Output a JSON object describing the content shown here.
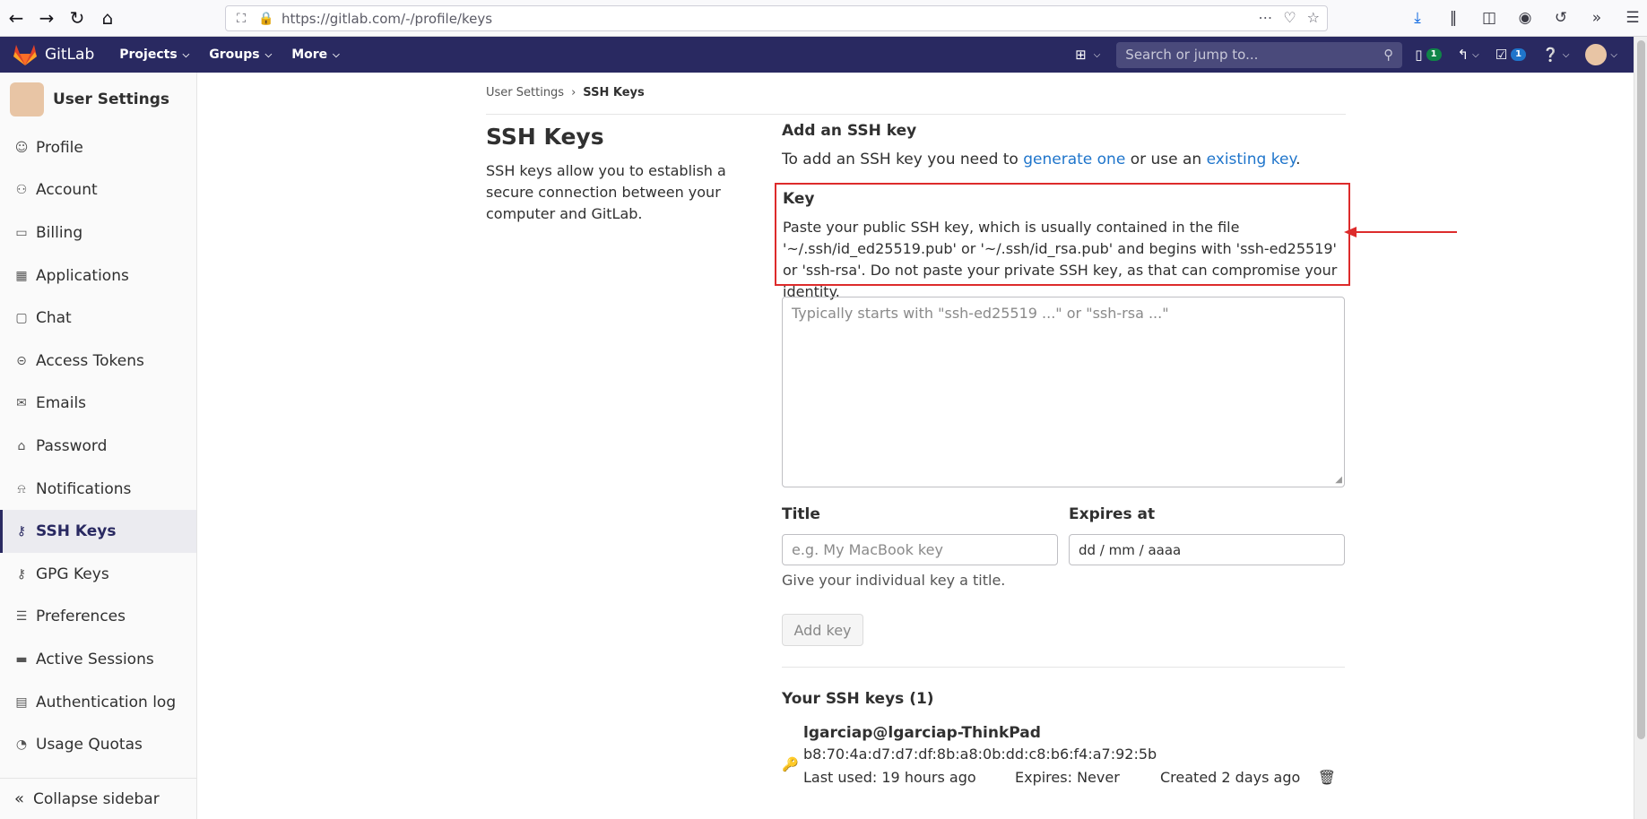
{
  "browser": {
    "url_prefix": "https://gitlab.com",
    "url_path": "/-/profile/keys"
  },
  "topnav": {
    "brand": "GitLab",
    "menus": [
      "Projects",
      "Groups",
      "More"
    ],
    "search_placeholder": "Search or jump to...",
    "mr_badge": "1",
    "todo_badge": "1"
  },
  "sidebar": {
    "title": "User Settings",
    "items": [
      {
        "label": "Profile",
        "icon": "profile-icon"
      },
      {
        "label": "Account",
        "icon": "account-icon"
      },
      {
        "label": "Billing",
        "icon": "billing-icon"
      },
      {
        "label": "Applications",
        "icon": "applications-icon"
      },
      {
        "label": "Chat",
        "icon": "chat-icon"
      },
      {
        "label": "Access Tokens",
        "icon": "token-icon"
      },
      {
        "label": "Emails",
        "icon": "email-icon"
      },
      {
        "label": "Password",
        "icon": "lock-icon"
      },
      {
        "label": "Notifications",
        "icon": "bell-icon"
      },
      {
        "label": "SSH Keys",
        "icon": "key-icon",
        "active": true
      },
      {
        "label": "GPG Keys",
        "icon": "key-icon"
      },
      {
        "label": "Preferences",
        "icon": "preferences-icon"
      },
      {
        "label": "Active Sessions",
        "icon": "monitor-icon"
      },
      {
        "label": "Authentication log",
        "icon": "log-icon"
      },
      {
        "label": "Usage Quotas",
        "icon": "quota-icon"
      }
    ],
    "collapse_label": "Collapse sidebar"
  },
  "breadcrumb": {
    "parent": "User Settings",
    "current": "SSH Keys"
  },
  "page": {
    "title": "SSH Keys",
    "description": "SSH keys allow you to establish a secure connection between your computer and GitLab."
  },
  "form": {
    "heading": "Add an SSH key",
    "intro_prefix": "To add an SSH key you need to ",
    "intro_link1": "generate one",
    "intro_middle": " or use an ",
    "intro_link2": "existing key",
    "intro_suffix": ".",
    "key_label": "Key",
    "key_hint": "Paste your public SSH key, which is usually contained in the file '~/.ssh/id_ed25519.pub' or '~/.ssh/id_rsa.pub' and begins with 'ssh-ed25519' or 'ssh-rsa'. Do not paste your private SSH key, as that can compromise your identity.",
    "key_placeholder": "Typically starts with \"ssh-ed25519 ...\" or \"ssh-rsa ...\"",
    "title_label": "Title",
    "title_placeholder": "e.g. My MacBook key",
    "expires_label": "Expires at",
    "expires_value": "dd / mm / aaaa",
    "title_help": "Give your individual key a title.",
    "add_button": "Add key"
  },
  "keys_list": {
    "heading": "Your SSH keys (1)",
    "items": [
      {
        "title": "lgarciap@lgarciap-ThinkPad",
        "fingerprint": "b8:70:4a:d7:d7:df:8b:a8:0b:dd:c8:b6:f4:a7:92:5b",
        "last_used": "Last used: 19 hours ago",
        "expires": "Expires: Never",
        "created": "Created 2 days ago"
      }
    ]
  },
  "colors": {
    "nav_bg": "#292961",
    "highlight_border": "#dd2b2b",
    "link": "#1f75cb"
  }
}
